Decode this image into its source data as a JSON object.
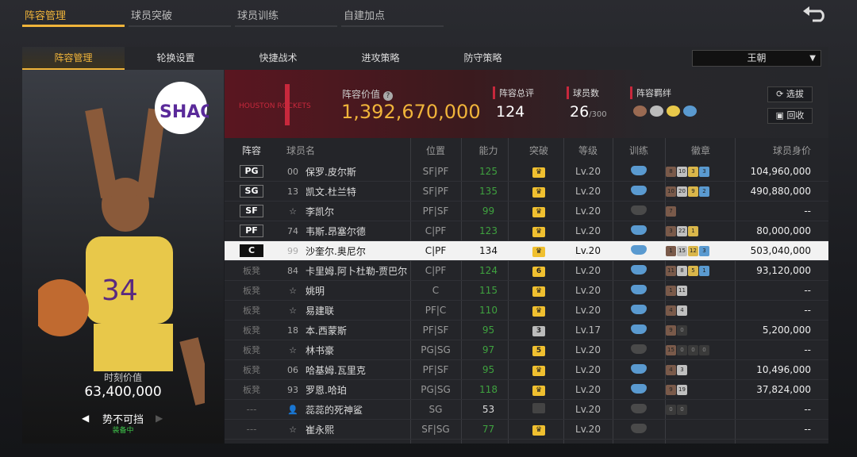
{
  "top_tabs": [
    "阵容管理",
    "球员突破",
    "球员训练",
    "自建加点"
  ],
  "sub_tabs": [
    "阵容管理",
    "轮换设置",
    "快捷战术",
    "进攻策略",
    "防守策略"
  ],
  "team_select": "王朝",
  "card": {
    "value_label": "时刻价值",
    "value": "63,400,000",
    "skill": "势不可挡",
    "equip_status": "装备中",
    "card_logo": "SHAQ"
  },
  "header": {
    "team_logo": "HOUSTON ROCKETS",
    "lineup_value_label": "阵容价值",
    "lineup_value": "1,392,670,000",
    "rating_label": "阵容总评",
    "rating": "124",
    "players_label": "球员数",
    "players": "26",
    "players_max": "/300",
    "bond_label": "阵容羁绊",
    "btn_select": "选拔",
    "btn_recycle": "回收"
  },
  "columns": [
    "阵容",
    "球员名",
    "位置",
    "能力",
    "突破",
    "等级",
    "训练",
    "徽章",
    "球员身价"
  ],
  "rows": [
    {
      "slot": "PG",
      "num": "00",
      "name": "保罗.皮尔斯",
      "pos": "SF|PF",
      "ability": "125",
      "brk": "",
      "level": "Lv.20",
      "value": "104,960,000",
      "badges": [
        "8",
        "10",
        "3",
        "3"
      ]
    },
    {
      "slot": "SG",
      "num": "13",
      "name": "凯文.杜兰特",
      "pos": "SF|PF",
      "ability": "135",
      "brk": "",
      "level": "Lv.20",
      "value": "490,880,000",
      "badges": [
        "10",
        "20",
        "9",
        "2"
      ]
    },
    {
      "slot": "SF",
      "num": "☆",
      "name": "李凯尔",
      "pos": "PF|SF",
      "ability": "99",
      "brk": "",
      "level": "Lv.20",
      "value": "--",
      "badges": [
        "7"
      ]
    },
    {
      "slot": "PF",
      "num": "74",
      "name": "韦斯.昂塞尔德",
      "pos": "C|PF",
      "ability": "123",
      "brk": "",
      "level": "Lv.20",
      "value": "80,000,000",
      "badges": [
        "3",
        "22",
        "1"
      ]
    },
    {
      "slot": "C",
      "num": "99",
      "name": "沙奎尔.奥尼尔",
      "pos": "C|PF",
      "ability": "134",
      "brk": "",
      "level": "Lv.20",
      "value": "503,040,000",
      "badges": [
        "1",
        "15",
        "12",
        "3"
      ]
    },
    {
      "slot": "板凳",
      "num": "84",
      "name": "卡里姆.阿卜杜勒-贾巴尔",
      "pos": "C|PF",
      "ability": "124",
      "brk": "6",
      "level": "Lv.20",
      "value": "93,120,000",
      "badges": [
        "11",
        "8",
        "5",
        "1"
      ]
    },
    {
      "slot": "板凳",
      "num": "☆",
      "name": "姚明",
      "pos": "C",
      "ability": "115",
      "brk": "",
      "level": "Lv.20",
      "value": "--",
      "badges": [
        "1",
        "11"
      ]
    },
    {
      "slot": "板凳",
      "num": "☆",
      "name": "易建联",
      "pos": "PF|C",
      "ability": "110",
      "brk": "",
      "level": "Lv.20",
      "value": "--",
      "badges": [
        "4",
        "4"
      ]
    },
    {
      "slot": "板凳",
      "num": "18",
      "name": "本.西蒙斯",
      "pos": "PF|SF",
      "ability": "95",
      "brk": "3",
      "level": "Lv.17",
      "value": "5,200,000",
      "badges": [
        "9",
        "0"
      ]
    },
    {
      "slot": "板凳",
      "num": "☆",
      "name": "林书豪",
      "pos": "PG|SG",
      "ability": "97",
      "brk": "5",
      "level": "Lv.20",
      "value": "--",
      "badges": [
        "15",
        "0",
        "0",
        "0"
      ]
    },
    {
      "slot": "板凳",
      "num": "06",
      "name": "哈基姆.瓦里克",
      "pos": "PF|SF",
      "ability": "95",
      "brk": "",
      "level": "Lv.20",
      "value": "10,496,000",
      "badges": [
        "4",
        "3"
      ]
    },
    {
      "slot": "板凳",
      "num": "93",
      "name": "罗恩.哈珀",
      "pos": "PG|SG",
      "ability": "118",
      "brk": "",
      "level": "Lv.20",
      "value": "37,824,000",
      "badges": [
        "9",
        "19"
      ]
    },
    {
      "slot": "---",
      "num": "👤",
      "name": "蕊蕊的死神鲨",
      "pos": "SG",
      "ability": "53",
      "brk": "",
      "level": "Lv.20",
      "value": "--",
      "badges": [
        "0",
        "0"
      ]
    },
    {
      "slot": "---",
      "num": "☆",
      "name": "崔永熙",
      "pos": "SF|SG",
      "ability": "77",
      "brk": "",
      "level": "Lv.20",
      "value": "--",
      "badges": []
    }
  ]
}
